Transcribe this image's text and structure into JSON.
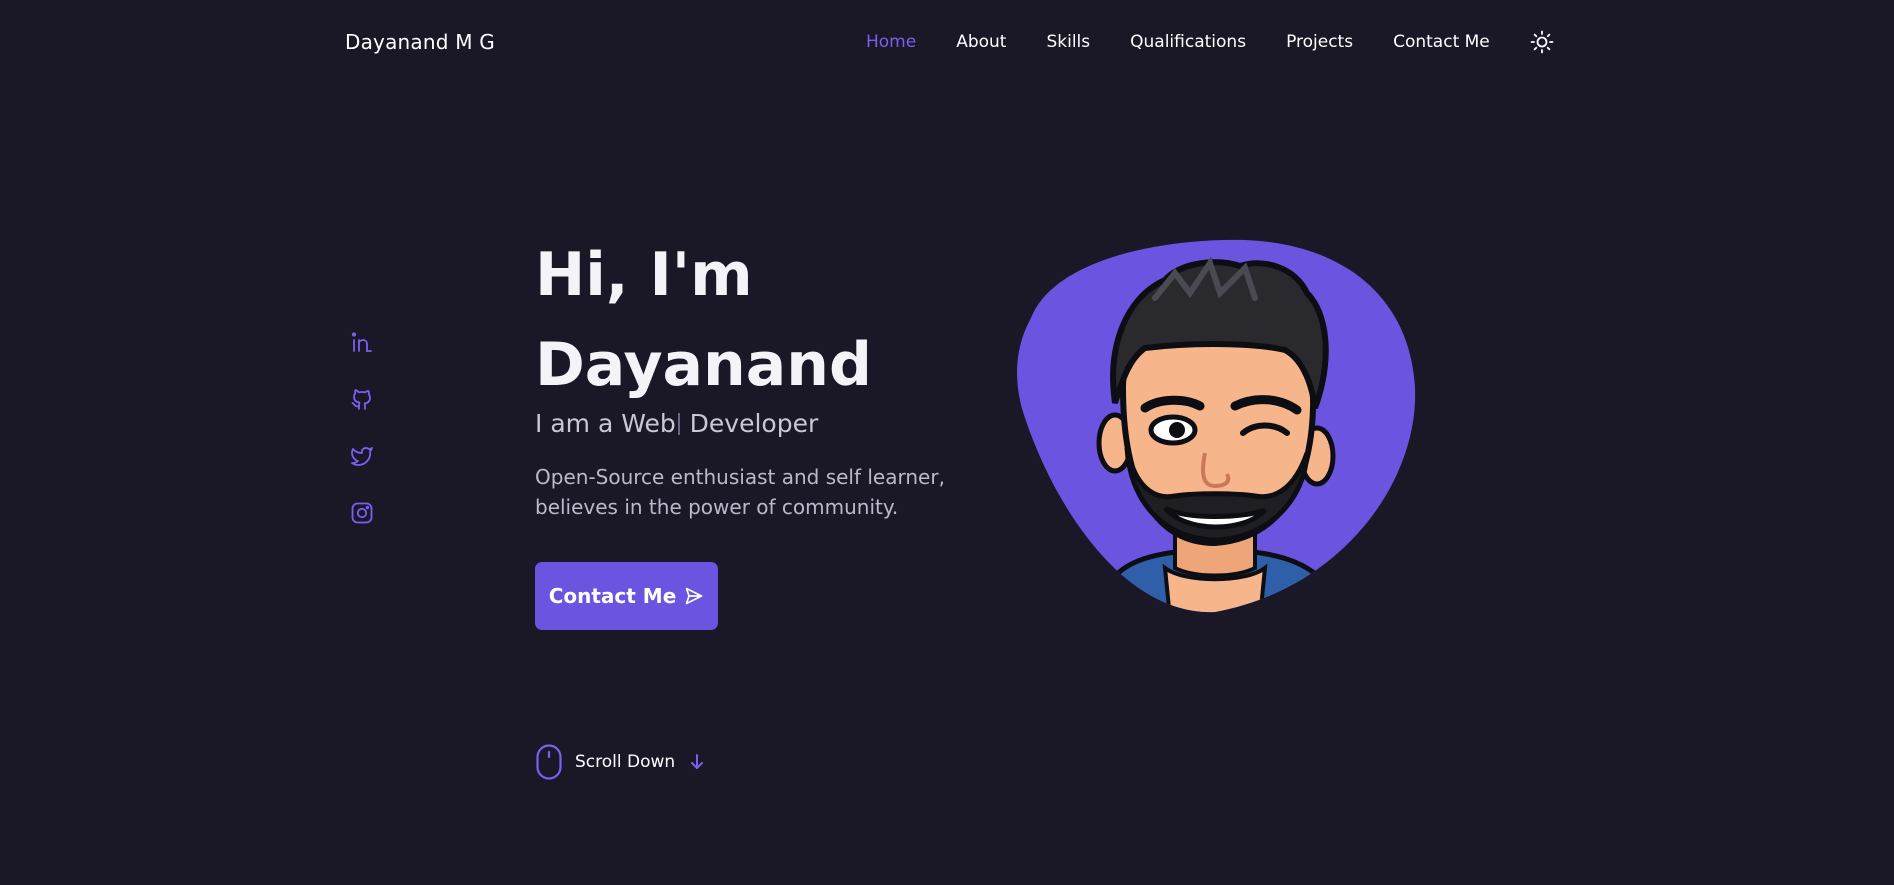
{
  "header": {
    "logo": "Dayanand M G",
    "nav": [
      "Home",
      "About",
      "Skills",
      "Qualifications",
      "Projects",
      "Contact Me"
    ],
    "active_nav": "Home",
    "theme_icon": "sun-icon"
  },
  "socials": [
    "linkedin-icon",
    "github-icon",
    "twitter-icon",
    "instagram-icon"
  ],
  "hero": {
    "greeting": "Hi, I'm",
    "name": "Dayanand",
    "subtitle_prefix": "I am a Web",
    "subtitle_suffix": " Developer",
    "description": "Open-Source enthusiast and self learner, believes in the power of community.",
    "cta_label": "Contact Me"
  },
  "scroll": {
    "label": "Scroll Down"
  },
  "colors": {
    "background": "#1a1727",
    "accent": "#6b55e0",
    "active_nav": "#7c5ff0",
    "text": "#f4f3f8"
  }
}
